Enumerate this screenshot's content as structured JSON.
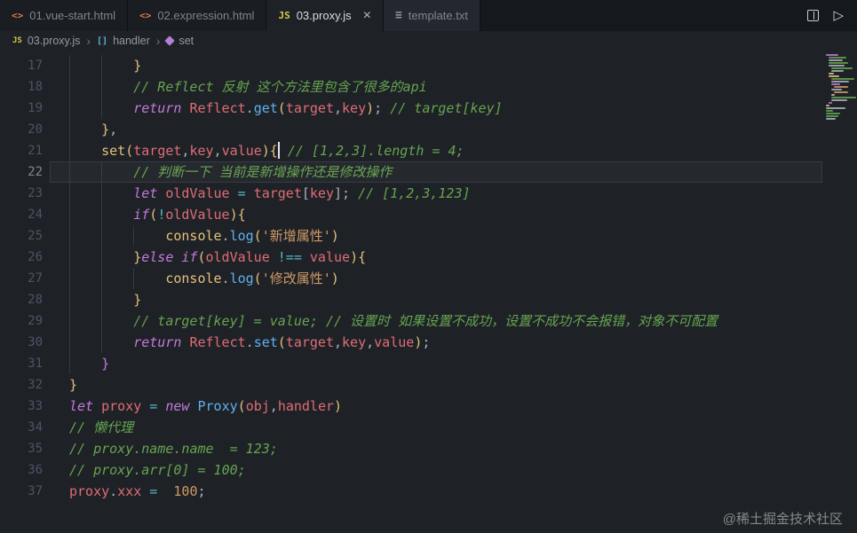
{
  "theme": {
    "accent": "#61afef",
    "editor_background": "#1e2227",
    "comment_green": "#66a44f",
    "keyword_magenta": "#c678dd",
    "string_orange": "#d19a66"
  },
  "icons": {
    "html_glyph": "<>",
    "js_glyph": "JS",
    "txt_glyph": "≡",
    "object_glyph": "[]",
    "close_glyph": "×",
    "run_glyph": "▷",
    "chevron_glyph": "›"
  },
  "tabbar": {
    "tabs": [
      {
        "label": "01.vue-start.html",
        "icon": "html",
        "active": false
      },
      {
        "label": "02.expression.html",
        "icon": "html",
        "active": false
      },
      {
        "label": "03.proxy.js",
        "icon": "js",
        "active": true
      },
      {
        "label": "template.txt",
        "icon": "txt",
        "active": false
      }
    ]
  },
  "breadcrumb": {
    "separator": "›",
    "items": [
      {
        "label": "03.proxy.js",
        "icon": "js"
      },
      {
        "label": "handler",
        "icon": "object"
      },
      {
        "label": "set",
        "icon": "method"
      }
    ]
  },
  "editor": {
    "first_line": 17,
    "last_line": 37,
    "cursor_line": 21,
    "lines": [
      {
        "n": 17,
        "ind": 2,
        "toks": [
          [
            "br1",
            "}"
          ]
        ]
      },
      {
        "n": 18,
        "ind": 2,
        "toks": [
          [
            "cm",
            "// Reflect 反射 这个方法里包含了很多的api"
          ]
        ]
      },
      {
        "n": 19,
        "ind": 2,
        "toks": [
          [
            "kw",
            "return "
          ],
          [
            "var",
            "Reflect"
          ],
          [
            "pun",
            "."
          ],
          [
            "fn",
            "get"
          ],
          [
            "br1",
            "("
          ],
          [
            "var",
            "target"
          ],
          [
            "pun",
            ","
          ],
          [
            "var",
            "key"
          ],
          [
            "br1",
            ")"
          ],
          [
            "pun",
            ";"
          ],
          [
            "cm",
            " // target[key]"
          ]
        ]
      },
      {
        "n": 20,
        "ind": 1,
        "toks": [
          [
            "br1",
            "}"
          ],
          [
            "pun",
            ","
          ]
        ]
      },
      {
        "n": 21,
        "ind": 1,
        "toks": [
          [
            "bi",
            "set"
          ],
          [
            "br1",
            "("
          ],
          [
            "var",
            "target"
          ],
          [
            "pun",
            ","
          ],
          [
            "var",
            "key"
          ],
          [
            "pun",
            ","
          ],
          [
            "var",
            "value"
          ],
          [
            "br1",
            ")"
          ],
          [
            "br1",
            "{"
          ],
          [
            "cur",
            ""
          ],
          [
            "cm",
            " // [1,2,3].length = 4;"
          ]
        ]
      },
      {
        "n": 22,
        "ind": 2,
        "current": true,
        "toks": [
          [
            "cm",
            "// 判断一下 当前是新增操作还是修改操作"
          ]
        ]
      },
      {
        "n": 23,
        "ind": 2,
        "toks": [
          [
            "kw",
            "let "
          ],
          [
            "var",
            "oldValue"
          ],
          [
            "op",
            " = "
          ],
          [
            "var",
            "target"
          ],
          [
            "pun",
            "["
          ],
          [
            "var",
            "key"
          ],
          [
            "pun",
            "]"
          ],
          [
            "pun",
            ";"
          ],
          [
            "cm",
            " // [1,2,3,123]"
          ]
        ]
      },
      {
        "n": 24,
        "ind": 2,
        "toks": [
          [
            "kw",
            "if"
          ],
          [
            "br1",
            "("
          ],
          [
            "op",
            "!"
          ],
          [
            "var",
            "oldValue"
          ],
          [
            "br1",
            ")"
          ],
          [
            "br1",
            "{"
          ]
        ]
      },
      {
        "n": 25,
        "ind": 3,
        "toks": [
          [
            "bi",
            "console"
          ],
          [
            "pun",
            "."
          ],
          [
            "fn",
            "log"
          ],
          [
            "br1",
            "("
          ],
          [
            "str",
            "'新增属性'"
          ],
          [
            "br1",
            ")"
          ]
        ]
      },
      {
        "n": 26,
        "ind": 2,
        "toks": [
          [
            "br1",
            "}"
          ],
          [
            "kw",
            "else "
          ],
          [
            "kw",
            "if"
          ],
          [
            "br1",
            "("
          ],
          [
            "var",
            "oldValue"
          ],
          [
            "op",
            " !== "
          ],
          [
            "var",
            "value"
          ],
          [
            "br1",
            ")"
          ],
          [
            "br1",
            "{"
          ]
        ]
      },
      {
        "n": 27,
        "ind": 3,
        "toks": [
          [
            "bi",
            "console"
          ],
          [
            "pun",
            "."
          ],
          [
            "fn",
            "log"
          ],
          [
            "br1",
            "("
          ],
          [
            "str",
            "'修改属性'"
          ],
          [
            "br1",
            ")"
          ]
        ]
      },
      {
        "n": 28,
        "ind": 2,
        "toks": [
          [
            "br1",
            "}"
          ]
        ]
      },
      {
        "n": 29,
        "ind": 2,
        "toks": [
          [
            "cm",
            "// target[key] = value; // 设置时 如果设置不成功，设置不成功不会报错，对象不可配置"
          ]
        ]
      },
      {
        "n": 30,
        "ind": 2,
        "toks": [
          [
            "kw",
            "return "
          ],
          [
            "var",
            "Reflect"
          ],
          [
            "pun",
            "."
          ],
          [
            "fn",
            "set"
          ],
          [
            "br1",
            "("
          ],
          [
            "var",
            "target"
          ],
          [
            "pun",
            ","
          ],
          [
            "var",
            "key"
          ],
          [
            "pun",
            ","
          ],
          [
            "var",
            "value"
          ],
          [
            "br1",
            ")"
          ],
          [
            "pun",
            ";"
          ]
        ]
      },
      {
        "n": 31,
        "ind": 1,
        "toks": [
          [
            "br2",
            "}"
          ]
        ]
      },
      {
        "n": 32,
        "ind": 0,
        "toks": [
          [
            "br1",
            "}"
          ]
        ]
      },
      {
        "n": 33,
        "ind": 0,
        "toks": [
          [
            "kw",
            "let "
          ],
          [
            "var",
            "proxy"
          ],
          [
            "op",
            " = "
          ],
          [
            "kw",
            "new "
          ],
          [
            "fn",
            "Proxy"
          ],
          [
            "br1",
            "("
          ],
          [
            "var",
            "obj"
          ],
          [
            "pun",
            ","
          ],
          [
            "var",
            "handler"
          ],
          [
            "br1",
            ")"
          ]
        ]
      },
      {
        "n": 34,
        "ind": 0,
        "toks": [
          [
            "cm",
            "// 懒代理"
          ]
        ]
      },
      {
        "n": 35,
        "ind": 0,
        "toks": [
          [
            "cm",
            "// proxy.name.name  = 123;"
          ]
        ]
      },
      {
        "n": 36,
        "ind": 0,
        "toks": [
          [
            "cm",
            "// proxy.arr[0] = 100;"
          ]
        ]
      },
      {
        "n": 37,
        "ind": 0,
        "toks": [
          [
            "var",
            "proxy"
          ],
          [
            "pun",
            "."
          ],
          [
            "var",
            "xxx"
          ],
          [
            "op",
            " = "
          ],
          [
            "num",
            " 100"
          ],
          [
            "pun",
            ";"
          ]
        ]
      }
    ]
  },
  "minimap": {
    "bars": [
      [
        0,
        14,
        "#c678dd"
      ],
      [
        1,
        20,
        "#66a44f"
      ],
      [
        1,
        16,
        "#abb2bf"
      ],
      [
        1,
        22,
        "#66a44f"
      ],
      [
        1,
        18,
        "#abb2bf"
      ],
      [
        2,
        24,
        "#66a44f"
      ],
      [
        2,
        14,
        "#abb2bf"
      ],
      [
        1,
        6,
        "#e5c07b"
      ],
      [
        1,
        12,
        "#e5c07b"
      ],
      [
        2,
        26,
        "#66a44f"
      ],
      [
        2,
        20,
        "#abb2bf"
      ],
      [
        2,
        10,
        "#c678dd"
      ],
      [
        3,
        16,
        "#d19a66"
      ],
      [
        2,
        12,
        "#abb2bf"
      ],
      [
        3,
        16,
        "#d19a66"
      ],
      [
        2,
        4,
        "#e5c07b"
      ],
      [
        2,
        28,
        "#66a44f"
      ],
      [
        2,
        18,
        "#abb2bf"
      ],
      [
        1,
        4,
        "#c678dd"
      ],
      [
        0,
        4,
        "#e5c07b"
      ],
      [
        0,
        22,
        "#abb2bf"
      ],
      [
        0,
        8,
        "#66a44f"
      ],
      [
        0,
        16,
        "#66a44f"
      ],
      [
        0,
        14,
        "#66a44f"
      ],
      [
        0,
        11,
        "#abb2bf"
      ]
    ]
  },
  "watermark": {
    "text": "@稀土掘金技术社区"
  }
}
